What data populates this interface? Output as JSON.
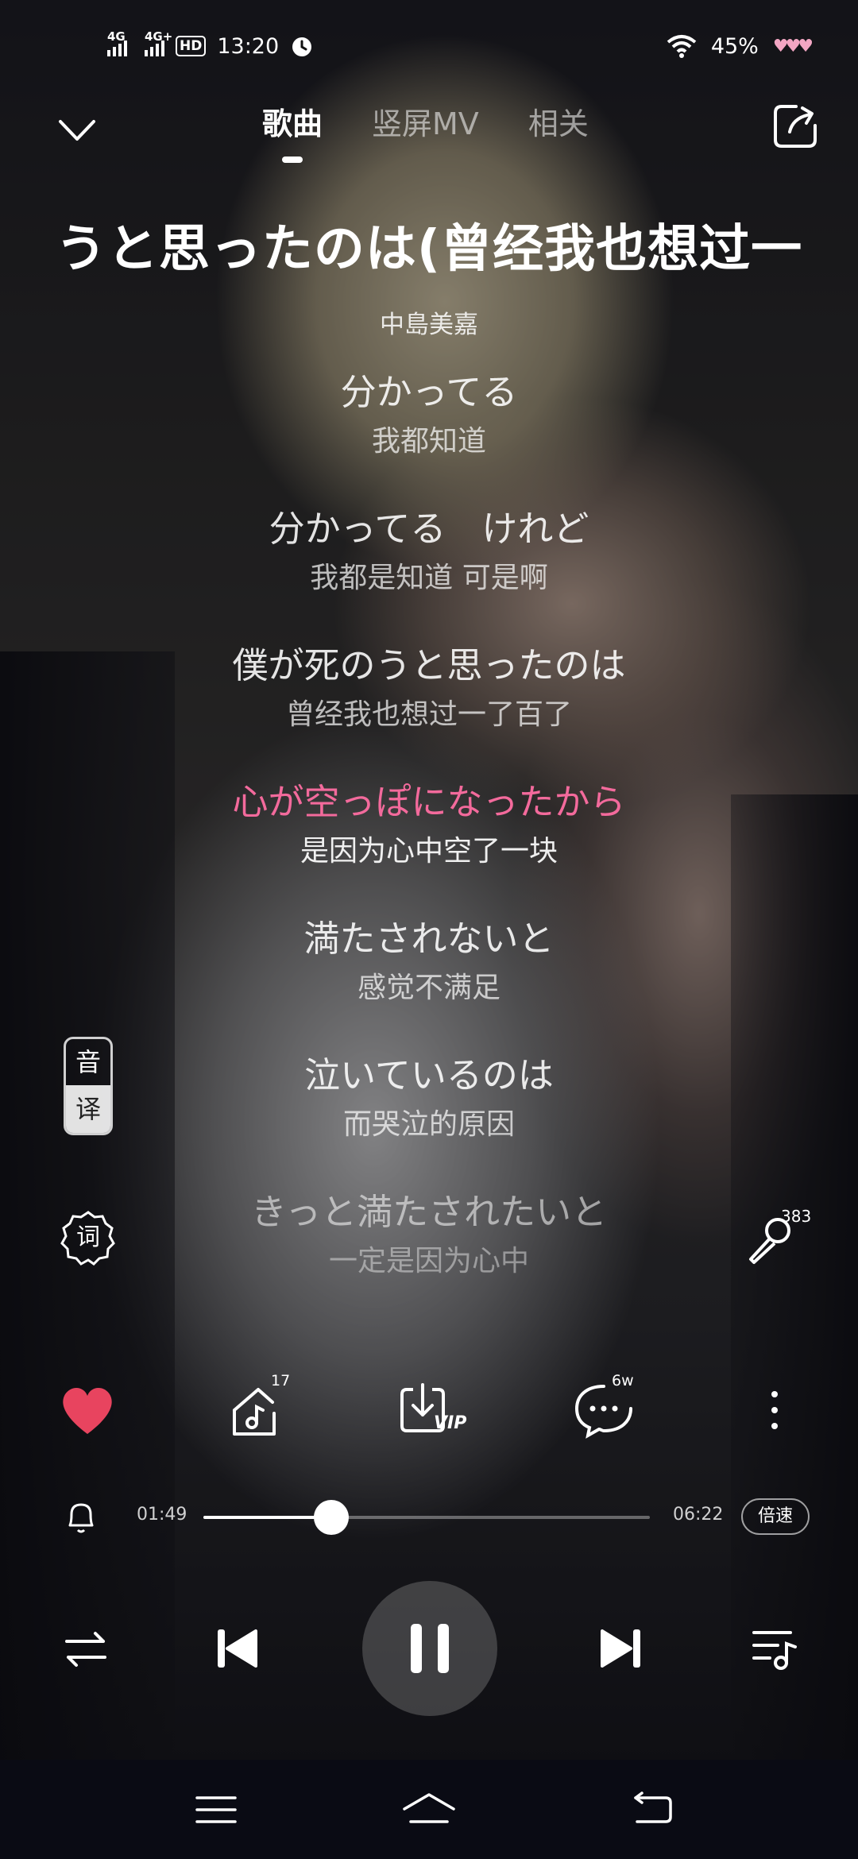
{
  "status_bar": {
    "net1": "4G",
    "net2": "4G+",
    "hd": "HD",
    "hd_sub": "1\n2",
    "time": "13:20",
    "battery": "45%",
    "hearts": "♥♥♥"
  },
  "nav": {
    "tabs": [
      "歌曲",
      "竖屏MV",
      "相关"
    ],
    "active_tab": 0
  },
  "song": {
    "title": "うと思ったのは(曾经我也想过一",
    "artist": "中島美嘉"
  },
  "lyrics": [
    {
      "orig": "分かってる",
      "trans": "我都知道"
    },
    {
      "orig": "分かってる　けれど",
      "trans": "我都是知道 可是啊"
    },
    {
      "orig": "僕が死のうと思ったのは",
      "trans": "曾经我也想过一了百了"
    },
    {
      "orig": "心が空っぽになったから",
      "trans": "是因为心中空了一块"
    },
    {
      "orig": "満たされないと",
      "trans": "感觉不满足"
    },
    {
      "orig": "泣いているのは",
      "trans": "而哭泣的原因"
    },
    {
      "orig": "きっと満たされたいと",
      "trans": "一定是因为心中"
    }
  ],
  "current_line": 3,
  "side": {
    "yinyi_top": "音",
    "yinyi_bottom": "译",
    "ci": "词",
    "mic_count": "383"
  },
  "actions": {
    "comment_count": "6w",
    "song_badge": "17",
    "download_vip": "VIP"
  },
  "player": {
    "current_time": "01:49",
    "total_time": "06:22",
    "progress": 0.286,
    "speed_label": "倍速"
  },
  "colors": {
    "accent": "#f36a9c",
    "like": "#e8445f"
  }
}
